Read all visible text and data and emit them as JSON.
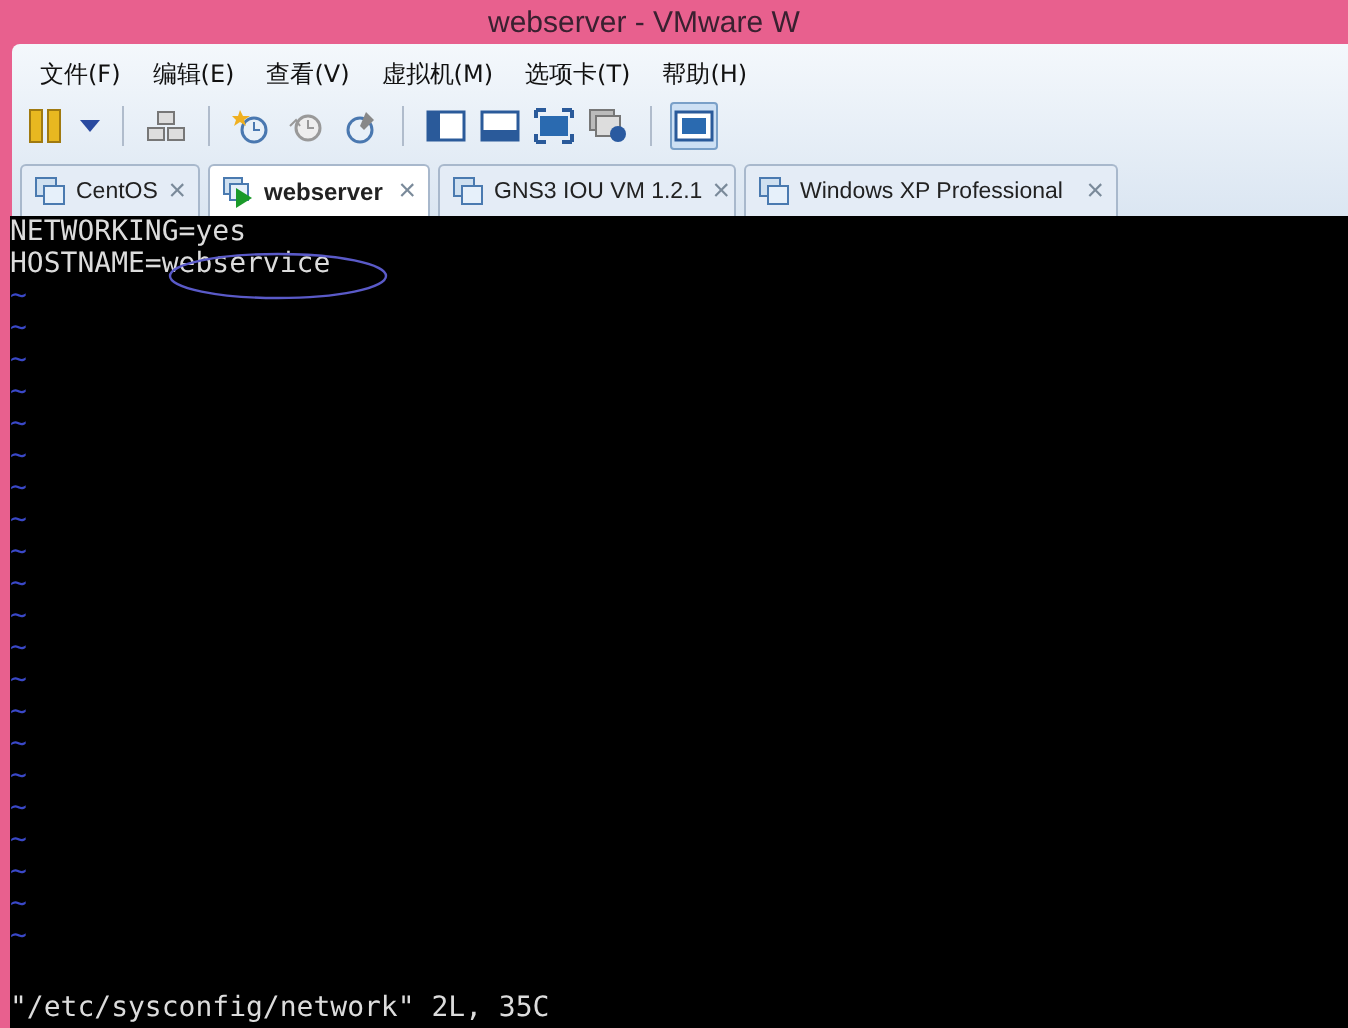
{
  "window": {
    "title": "webserver - VMware W"
  },
  "menu": [
    "文件(F)",
    "编辑(E)",
    "查看(V)",
    "虚拟机(M)",
    "选项卡(T)",
    "帮助(H)"
  ],
  "toolbar": [
    {
      "kind": "pause"
    },
    {
      "kind": "dropdown"
    },
    {
      "kind": "sep"
    },
    {
      "kind": "network"
    },
    {
      "kind": "sep"
    },
    {
      "kind": "snapshot"
    },
    {
      "kind": "revert"
    },
    {
      "kind": "manage"
    },
    {
      "kind": "sep"
    },
    {
      "kind": "sidebar"
    },
    {
      "kind": "thumbs"
    },
    {
      "kind": "fullscreen"
    },
    {
      "kind": "unity"
    },
    {
      "kind": "sep"
    },
    {
      "kind": "console",
      "pressed": true
    }
  ],
  "tabs": [
    {
      "label": "CentOS",
      "selected": false,
      "running": false,
      "close": "×"
    },
    {
      "label": "webserver",
      "selected": true,
      "running": true,
      "close": "×"
    },
    {
      "label": "GNS3 IOU VM 1.2.1",
      "selected": false,
      "running": false,
      "close": "×"
    },
    {
      "label": "Windows XP Professional",
      "selected": false,
      "running": false,
      "close": "×"
    }
  ],
  "terminal": {
    "lines": [
      {
        "text": "NETWORKING=yes",
        "circled": false
      },
      {
        "text": "HOSTNAME=webservice",
        "circled": true
      }
    ],
    "tildes": [
      "~",
      "~",
      "~",
      "~",
      "~",
      "~",
      "~",
      "~",
      "~",
      "~",
      "~",
      "~",
      "~",
      "~",
      "~",
      "~",
      "~",
      "~",
      "~",
      "~",
      "~"
    ],
    "status": "\"/etc/sysconfig/network\" 2L, 35C"
  }
}
